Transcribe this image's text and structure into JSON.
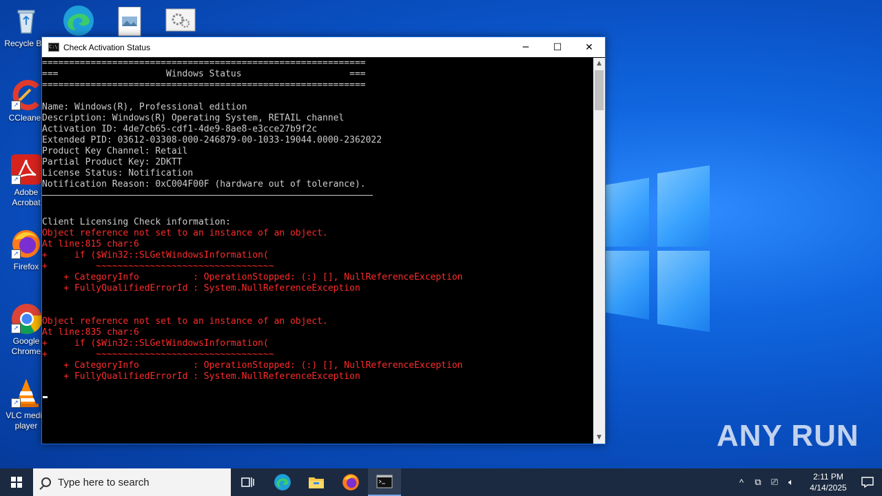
{
  "desktop": {
    "icons": [
      {
        "label": "Recycle Bin",
        "icon": "recycle-bin-icon"
      },
      {
        "label": "CCleaner",
        "icon": "ccleaner-icon"
      },
      {
        "label": "Adobe Acrobat",
        "icon": "adobe-acrobat-icon"
      },
      {
        "label": "Firefox",
        "icon": "firefox-icon"
      },
      {
        "label": "Google Chrome",
        "icon": "chrome-icon"
      },
      {
        "label": "VLC media player",
        "icon": "vlc-icon"
      }
    ],
    "top_icons": [
      "edge-icon",
      "image-file-icon",
      "settings-file-icon"
    ],
    "watermark": "ANY RUN"
  },
  "window": {
    "title": "Check Activation Status",
    "buttons": {
      "minimize": "─",
      "maximize": "☐",
      "close": "✕"
    }
  },
  "console": {
    "lines": [
      {
        "text": "============================================================",
        "type": "normal"
      },
      {
        "text": "===                    Windows Status                    ===",
        "type": "normal"
      },
      {
        "text": "============================================================",
        "type": "normal"
      },
      {
        "text": "",
        "type": "normal"
      },
      {
        "text": "Name: Windows(R), Professional edition",
        "type": "normal"
      },
      {
        "text": "Description: Windows(R) Operating System, RETAIL channel",
        "type": "normal"
      },
      {
        "text": "Activation ID: 4de7cb65-cdf1-4de9-8ae8-e3cce27b9f2c",
        "type": "normal"
      },
      {
        "text": "Extended PID: 03612-03308-000-246879-00-1033-19044.0000-2362022",
        "type": "normal"
      },
      {
        "text": "Product Key Channel: Retail",
        "type": "normal"
      },
      {
        "text": "Partial Product Key: 2DKTT",
        "type": "normal"
      },
      {
        "text": "License Status: Notification",
        "type": "normal"
      },
      {
        "text": "Notification Reason: 0xC004F00F (hardware out of tolerance).",
        "type": "normal"
      },
      {
        "text": "",
        "type": "rule"
      },
      {
        "text": "",
        "type": "normal"
      },
      {
        "text": "Client Licensing Check information:",
        "type": "normal"
      },
      {
        "text": "Object reference not set to an instance of an object.",
        "type": "err"
      },
      {
        "text": "At line:815 char:6",
        "type": "err"
      },
      {
        "text": "+     if ($Win32::SLGetWindowsInformation(",
        "type": "err"
      },
      {
        "text": "+         ~~~~~~~~~~~~~~~~~~~~~~~~~~~~~~~~~",
        "type": "err"
      },
      {
        "text": "    + CategoryInfo          : OperationStopped: (:) [], NullReferenceException",
        "type": "err"
      },
      {
        "text": "    + FullyQualifiedErrorId : System.NullReferenceException",
        "type": "err"
      },
      {
        "text": "",
        "type": "normal"
      },
      {
        "text": "",
        "type": "normal"
      },
      {
        "text": "Object reference not set to an instance of an object.",
        "type": "err"
      },
      {
        "text": "At line:835 char:6",
        "type": "err"
      },
      {
        "text": "+     if ($Win32::SLGetWindowsInformation(",
        "type": "err"
      },
      {
        "text": "+         ~~~~~~~~~~~~~~~~~~~~~~~~~~~~~~~~~",
        "type": "err"
      },
      {
        "text": "    + CategoryInfo          : OperationStopped: (:) [], NullReferenceException",
        "type": "err"
      },
      {
        "text": "    + FullyQualifiedErrorId : System.NullReferenceException",
        "type": "err"
      }
    ]
  },
  "taskbar": {
    "search_placeholder": "Type here to search",
    "pinned": [
      "task-view-icon",
      "edge-icon",
      "file-explorer-icon",
      "firefox-icon",
      "console-icon"
    ],
    "time": "2:11 PM",
    "date": "4/14/2025"
  },
  "colors": {
    "error_text": "#ff2b2b",
    "console_text": "#cccccc",
    "taskbar": "#1b2a40"
  }
}
